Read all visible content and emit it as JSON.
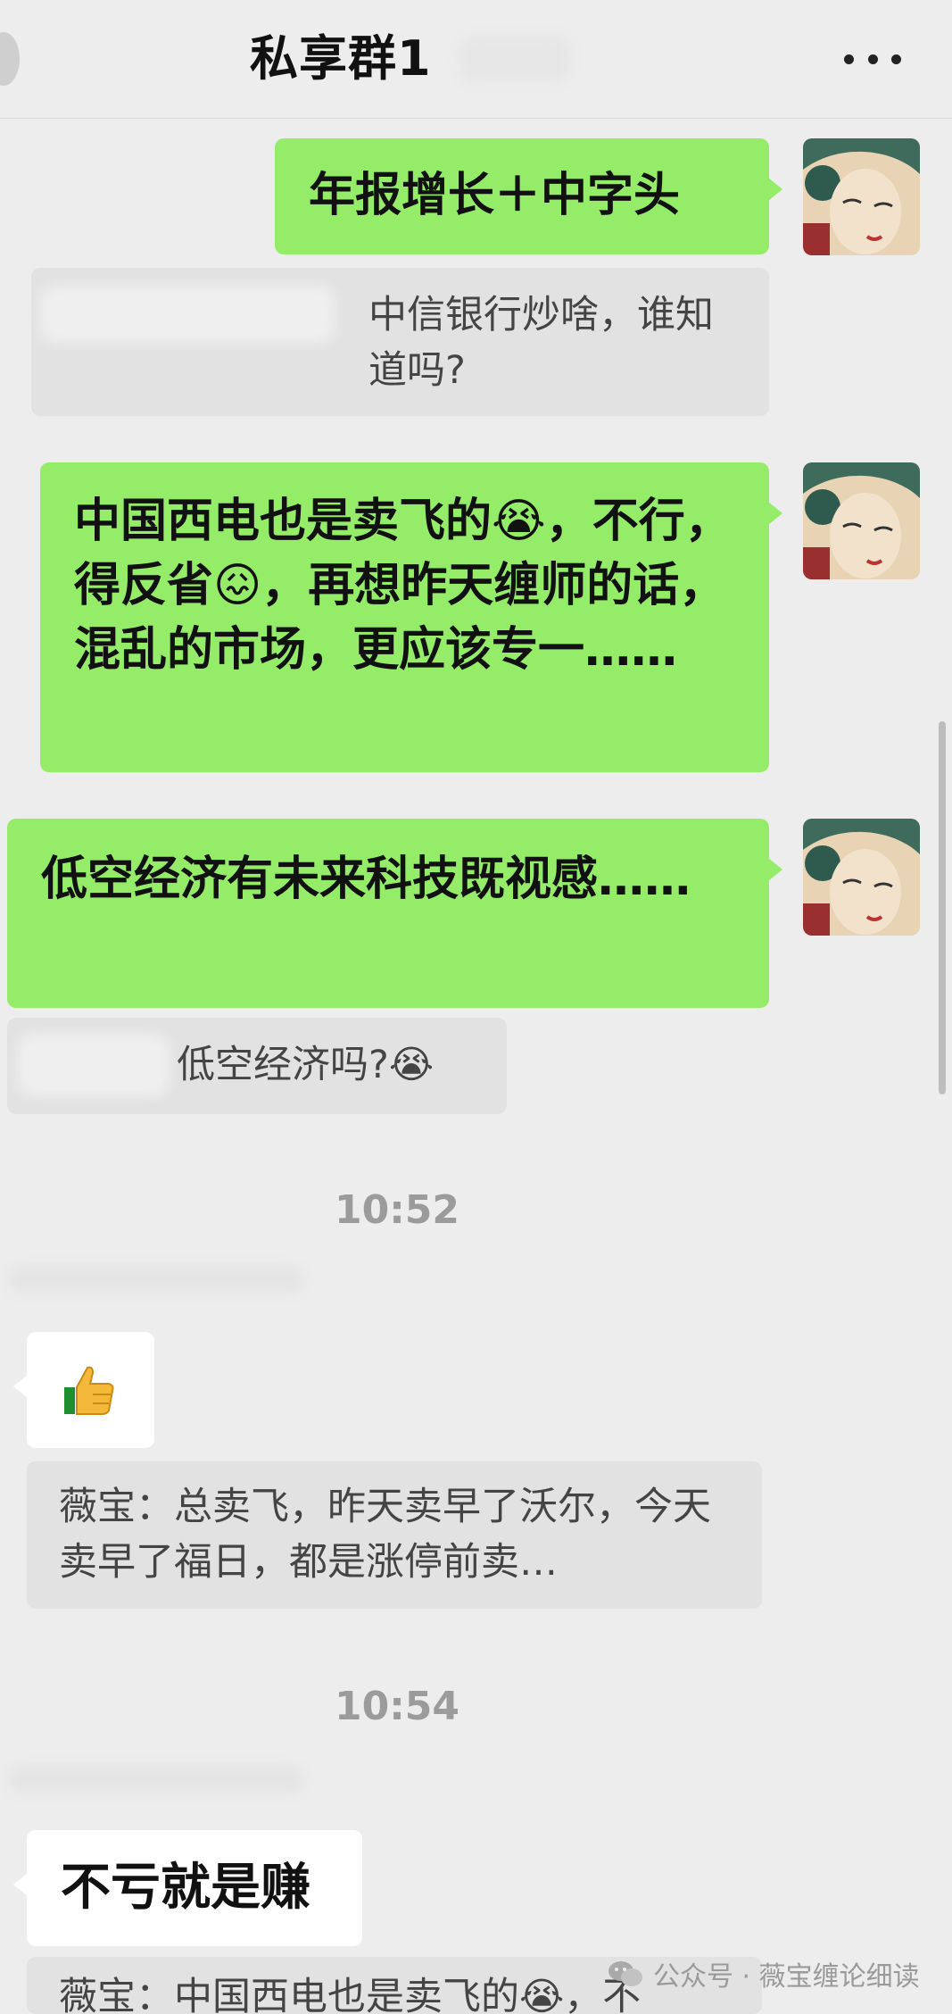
{
  "header": {
    "title": "私享群1",
    "back_icon": "back-arrow-icon",
    "more_icon": "more-dots-icon"
  },
  "messages": [
    {
      "text": "年报增长＋中字头"
    },
    {
      "quote": "中信银行炒啥，谁知道吗?"
    },
    {
      "text": "中国西电也是卖飞的😭，不行，得反省😖，再想昨天缠师的话，混乱的市场，更应该专一……"
    },
    {
      "text": "低空经济有未来科技既视感……"
    },
    {
      "quote": "低空经济吗?😭"
    }
  ],
  "time1": "10:52",
  "reply1": {
    "text": "👍",
    "quote": "薇宝：总卖飞，昨天卖早了沃尔，今天卖早了福日，都是涨停前卖…"
  },
  "time2": "10:54",
  "reply2": {
    "text": "不亏就是赚",
    "quote": "薇宝：中国西电也是卖飞的😭，不"
  },
  "watermark": "公众号 · 薇宝缠论细读",
  "colors": {
    "outgoing_bubble": "#95ec69",
    "incoming_bubble": "#ffffff",
    "quote_bg": "#e2e2e2",
    "background": "#ededed"
  }
}
